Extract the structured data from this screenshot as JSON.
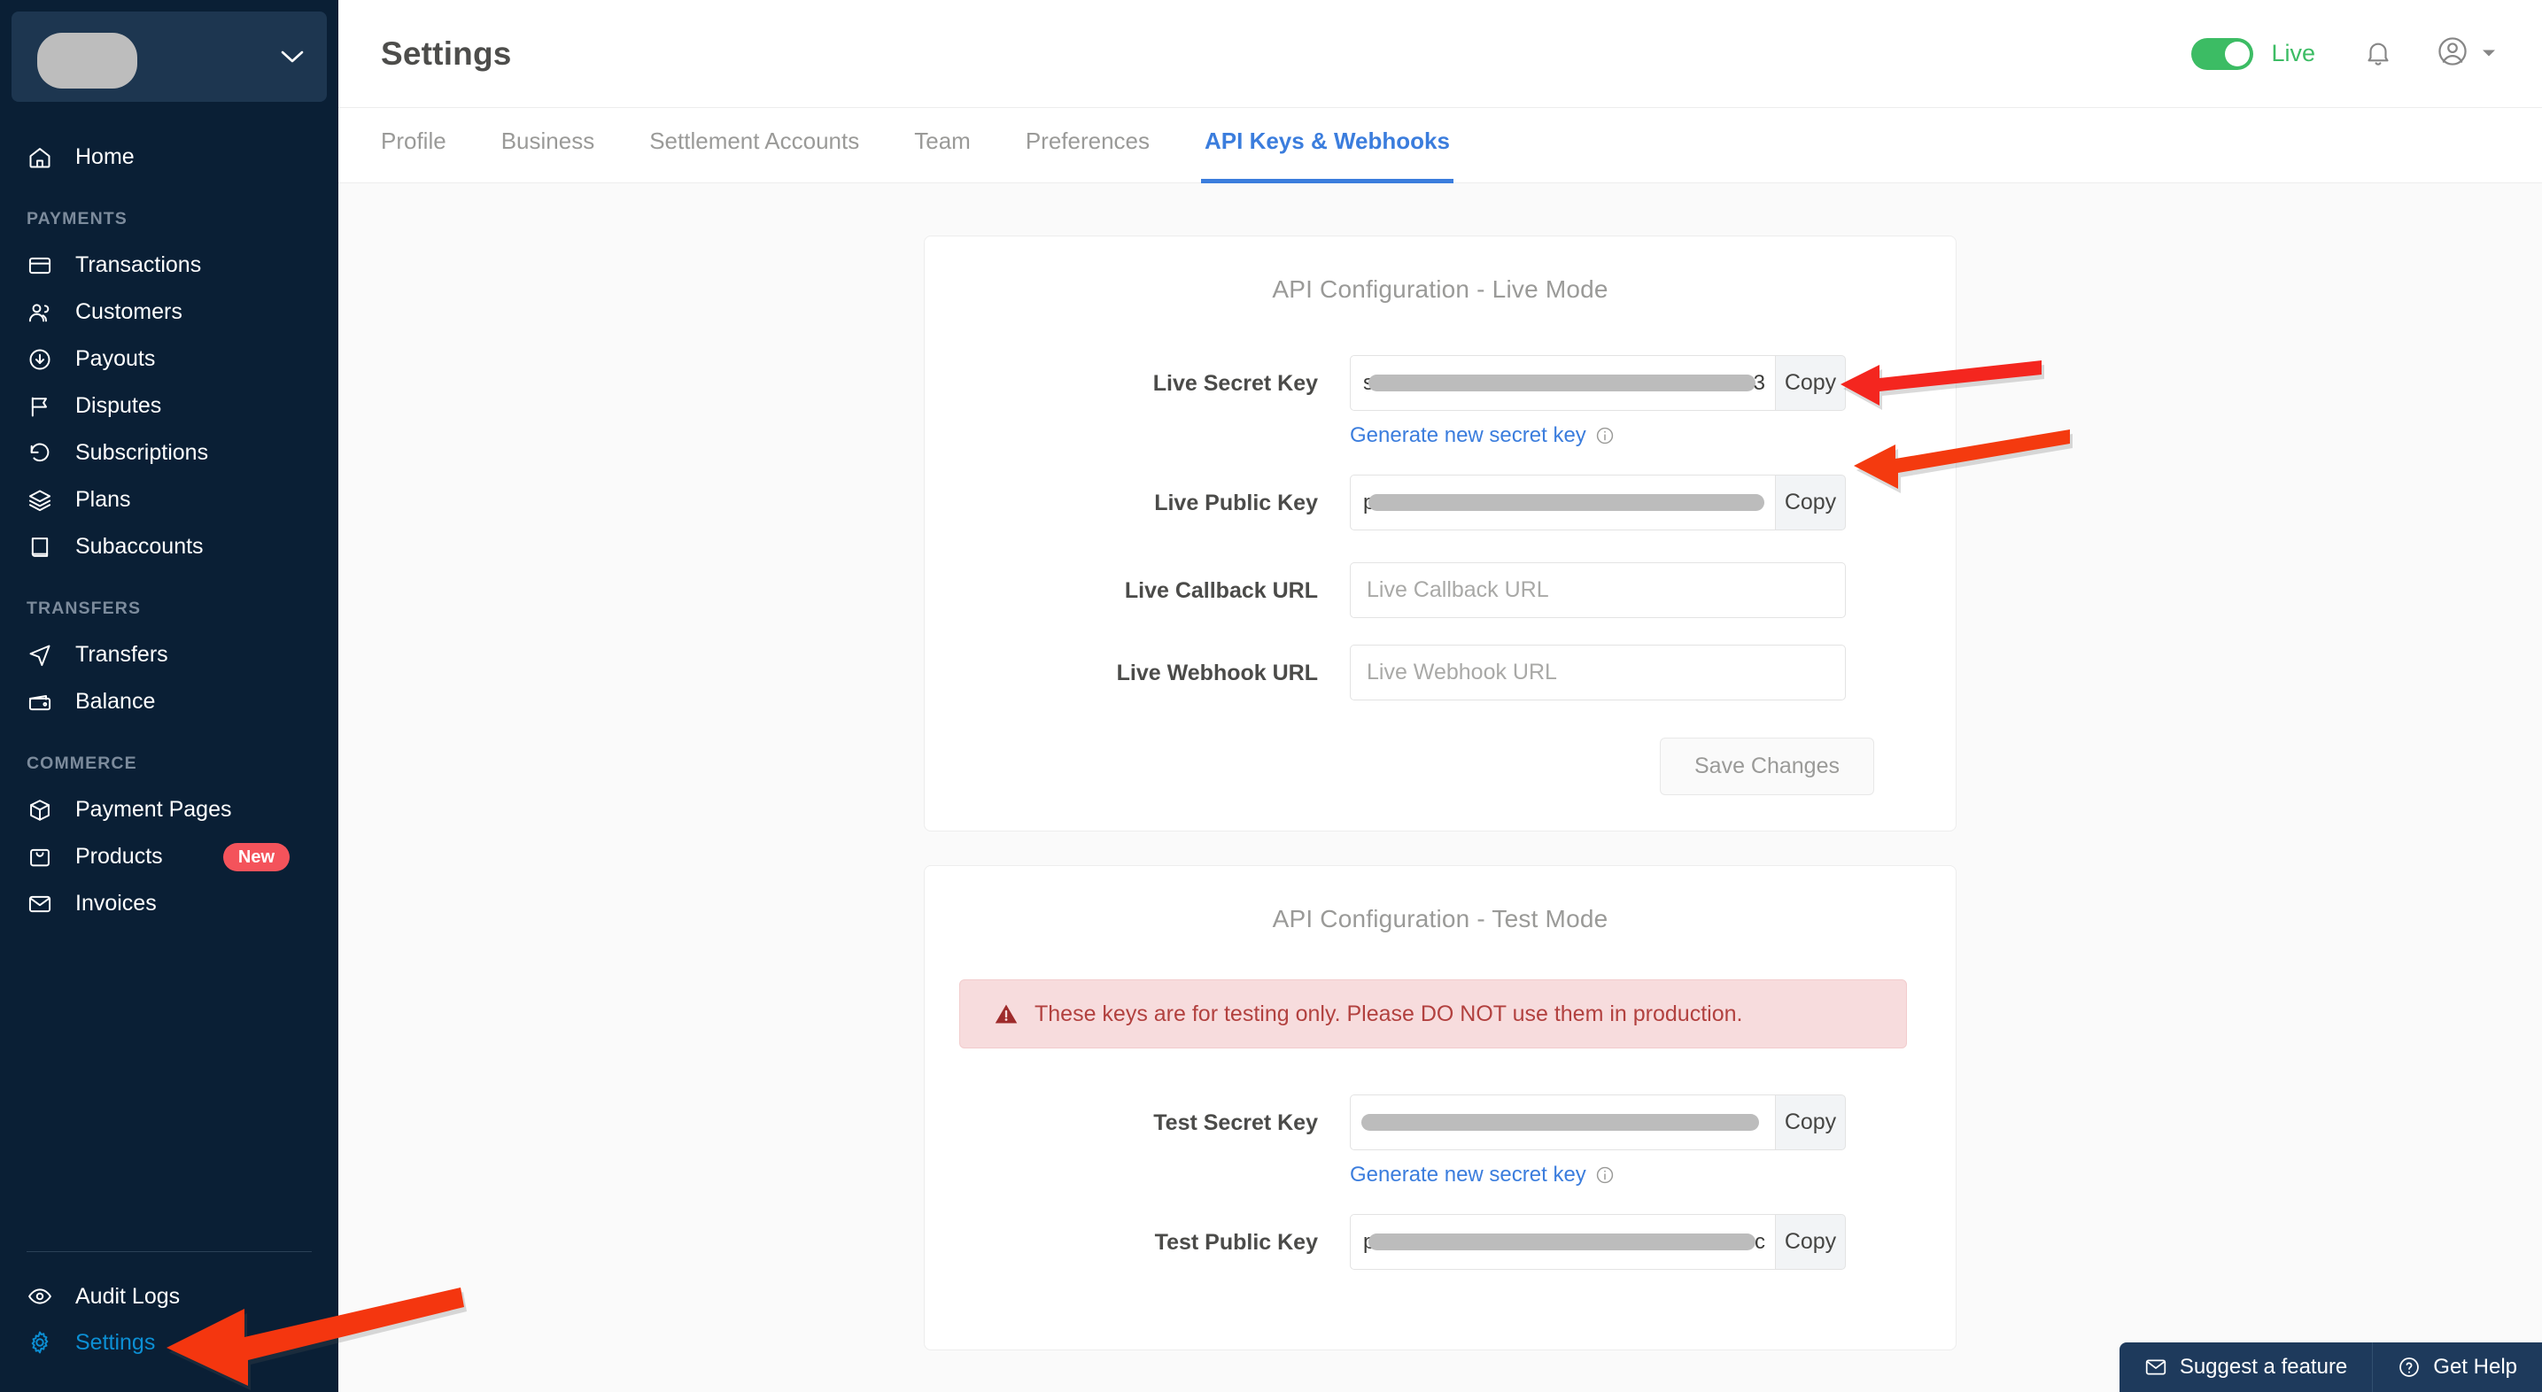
{
  "sidebar": {
    "account": {
      "name": "",
      "redacted": true,
      "chevron_icon": "chevron-down-icon"
    },
    "top_items": [
      {
        "label": "Home",
        "icon": "home-icon"
      }
    ],
    "groups": [
      {
        "label": "PAYMENTS",
        "items": [
          {
            "label": "Transactions",
            "icon": "credit-card-icon"
          },
          {
            "label": "Customers",
            "icon": "users-icon"
          },
          {
            "label": "Payouts",
            "icon": "arrow-down-circle-icon"
          },
          {
            "label": "Disputes",
            "icon": "flag-icon"
          },
          {
            "label": "Subscriptions",
            "icon": "refresh-ccw-icon"
          },
          {
            "label": "Plans",
            "icon": "layers-icon"
          },
          {
            "label": "Subaccounts",
            "icon": "book-icon"
          }
        ]
      },
      {
        "label": "TRANSFERS",
        "items": [
          {
            "label": "Transfers",
            "icon": "send-icon"
          },
          {
            "label": "Balance",
            "icon": "wallet-icon"
          }
        ]
      },
      {
        "label": "COMMERCE",
        "items": [
          {
            "label": "Payment Pages",
            "icon": "package-icon"
          },
          {
            "label": "Products",
            "icon": "shopping-bag-icon",
            "badge": "New"
          },
          {
            "label": "Invoices",
            "icon": "mail-icon"
          }
        ]
      }
    ],
    "bottom_items": [
      {
        "label": "Audit Logs",
        "icon": "eye-icon",
        "active": false
      },
      {
        "label": "Settings",
        "icon": "gear-icon",
        "active": true
      }
    ]
  },
  "header": {
    "title": "Settings",
    "mode_toggle": {
      "state": "on",
      "label": "Live",
      "color": "#3cbc64"
    },
    "notifications_icon": "bell-icon",
    "account_icon": "user-circle-icon",
    "account_caret_icon": "caret-down-icon"
  },
  "tabs": [
    {
      "label": "Profile",
      "active": false
    },
    {
      "label": "Business",
      "active": false
    },
    {
      "label": "Settlement Accounts",
      "active": false
    },
    {
      "label": "Team",
      "active": false
    },
    {
      "label": "Preferences",
      "active": false
    },
    {
      "label": "API Keys & Webhooks",
      "active": true
    }
  ],
  "live_card": {
    "title": "API Configuration - Live Mode",
    "secret_key": {
      "label": "Live Secret Key",
      "value_prefix": "s",
      "value_suffix": "3",
      "redacted": true,
      "copy_label": "Copy",
      "generate_link": "Generate new secret key",
      "info_icon": "info-icon"
    },
    "public_key": {
      "label": "Live Public Key",
      "value_prefix": "p",
      "value_suffix": "",
      "redacted": true,
      "copy_label": "Copy"
    },
    "callback_url": {
      "label": "Live Callback URL",
      "value": "",
      "placeholder": "Live Callback URL"
    },
    "webhook_url": {
      "label": "Live Webhook URL",
      "value": "",
      "placeholder": "Live Webhook URL"
    },
    "save_label": "Save Changes"
  },
  "test_card": {
    "title": "API Configuration - Test Mode",
    "warning": {
      "icon": "alert-triangle-icon",
      "text": "These keys are for testing only. Please DO NOT use them in production."
    },
    "secret_key": {
      "label": "Test Secret Key",
      "value_prefix": "",
      "value_suffix": "",
      "redacted": true,
      "copy_label": "Copy",
      "generate_link": "Generate new secret key",
      "info_icon": "info-icon"
    },
    "public_key": {
      "label": "Test Public Key",
      "value_prefix": "p",
      "value_suffix": "c",
      "redacted": true,
      "copy_label": "Copy"
    }
  },
  "help_bar": {
    "suggest": {
      "label": "Suggest a feature",
      "icon": "envelope-icon"
    },
    "get_help": {
      "label": "Get Help",
      "icon": "question-circle-icon"
    }
  },
  "annotations": {
    "arrow_color_secret": "#f4261f",
    "arrow_color_public": "#f43a0f",
    "arrow_color_settings": "#f4360f",
    "count": 3
  },
  "colors": {
    "sidebar_bg": "#0a1f35",
    "accent_blue": "#3b7ddd",
    "active_nav": "#0c8fd4",
    "live_green": "#3cbc64",
    "badge_red": "#f4535b",
    "warn_bg": "#f7dcdd",
    "warn_text": "#b2413f"
  }
}
